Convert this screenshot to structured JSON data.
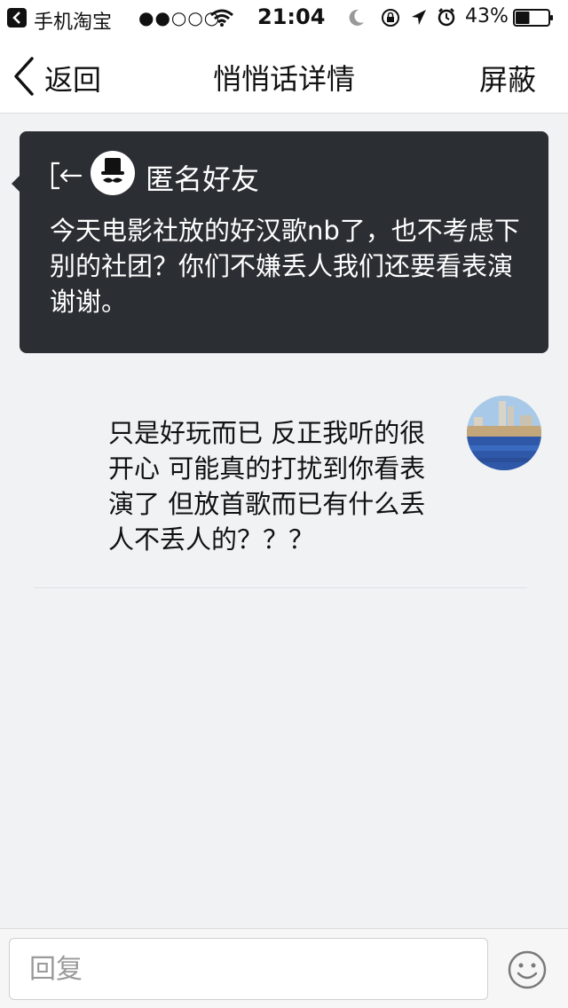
{
  "status_bar": {
    "app_name": "手机淘宝",
    "signal": "●●○○○",
    "time": "21:04",
    "battery_percent": "43%",
    "battery_level": 0.43
  },
  "nav": {
    "back_label": "返回",
    "title": "悄悄话详情",
    "block_label": "屏蔽"
  },
  "message": {
    "sender_name": "匿名好友",
    "text": "今天电影社放的好汉歌nb了，也不考虑下别的社团？你们不嫌丢人我们还要看表演谢谢。"
  },
  "reply": {
    "text": "只是好玩而已 反正我听的很开心 可能真的打扰到你看表演了 但放首歌而已有什么丢人不丢人的？？？"
  },
  "input": {
    "placeholder": "回复"
  },
  "colors": {
    "card_bg": "#2b2e33",
    "page_bg": "#f1f2f4"
  }
}
